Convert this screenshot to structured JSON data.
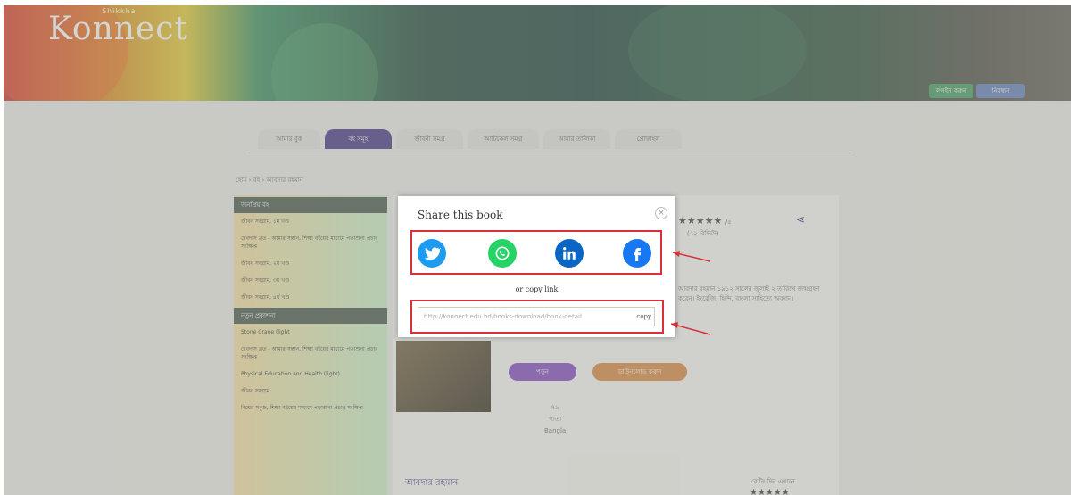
{
  "brand": {
    "logo_text": "Konnect",
    "logo_small": "Shikkha"
  },
  "header_buttons": [
    "লগইন করুন",
    "নিবন্ধন"
  ],
  "tabs": [
    "আমার বুক",
    "বই সমূহ",
    "জীবনী সমগ্র",
    "আর্টিকেল সমগ্র",
    "আমার তালিকা",
    "প্রোফাইল"
  ],
  "breadcrumb": "হোম › বই › আবদার রহমান",
  "sidebar": {
    "section1": "জনপ্রিয় বই",
    "items1": [
      "জীবন সংগ্রাম, ১ম খণ্ড",
      "দেবদাস ব্রত - আমার সন্তান, শিক্ষা বইয়ের মাধ্যমে পড়াশুনা প্রচার সংক্ষিপ্ত",
      "জীবন সংগ্রাম, ২য় খণ্ড",
      "জীবন সংগ্রাম, ৩য় খণ্ড",
      "জীবন সংগ্রাম, ৪র্থ খণ্ড"
    ],
    "section2": "নতুন প্রকাশনা",
    "items2": [
      "Stone Crane (light",
      "দেবদাস ব্রত - আমার সন্তান, শিক্ষা বইয়ের মাধ্যমে পড়াশুনা প্রচার সংক্ষিপ্ত",
      "Physical Education and Health (light)",
      "জীবন সংগ্রাম",
      "বিশ্বের সবুজ, শিক্ষা বইয়ের মাধ্যমে পড়াশুনা প্রচার সংক্ষিপ্ত"
    ]
  },
  "book": {
    "rating_text": "/৫",
    "review_count": "(১২ রিভিউ)",
    "desc": "আবদার রহমান ১৯১২ সালের জুলাই ২ তারিখে জন্মগ্রহণ করেন। ইংরেজি, হিন্দি, বাংলা সাহিত্যে অবদান।",
    "read_btn": "পড়ুন",
    "download_btn": "ডাউনলোড করুন",
    "meta": [
      "৭৯",
      "পাতা",
      "Bangla"
    ],
    "author_heading": "আবদার রহমান",
    "rate_label": "রেটিং দিন এখানে"
  },
  "modal": {
    "title": "Share this book",
    "close": "×",
    "or_copy": "or copy link",
    "link_value": "http://konnect.edu.bd/books-download/book-detail",
    "copy_label": "copy",
    "social": [
      "twitter",
      "whatsapp",
      "linkedin",
      "facebook"
    ]
  },
  "colors": {
    "accent": "#3d2b84",
    "highlight": "#d9303a",
    "twitter": "#1d9bf0",
    "whatsapp": "#25d366",
    "linkedin": "#0a66c2",
    "facebook": "#1877f2"
  }
}
